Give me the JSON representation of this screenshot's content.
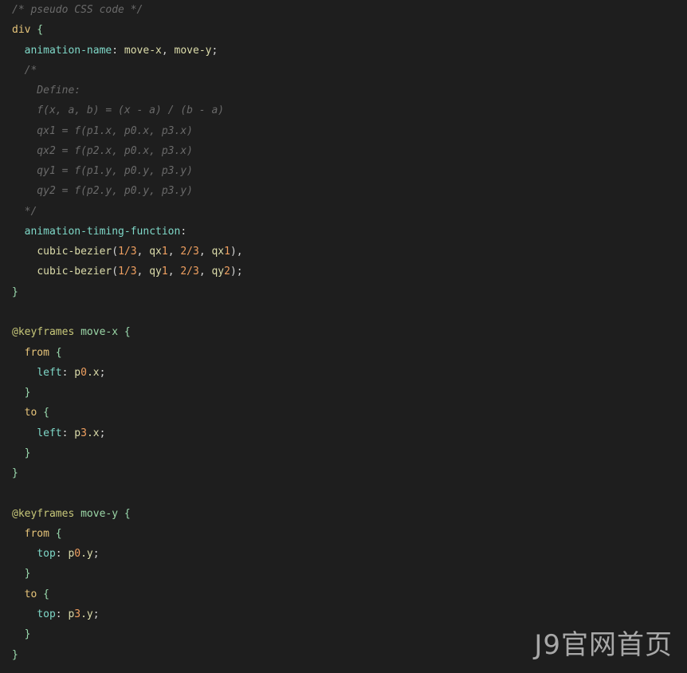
{
  "code": {
    "lines": [
      [
        {
          "t": "/* pseudo CSS code */",
          "c": "t-comment"
        }
      ],
      [
        {
          "t": "div",
          "c": "t-sel"
        },
        {
          "t": " {",
          "c": "t-brace"
        }
      ],
      [
        {
          "t": "  ",
          "c": "t-punct"
        },
        {
          "t": "animation-name",
          "c": "t-prop2"
        },
        {
          "t": ": ",
          "c": "t-punct"
        },
        {
          "t": "move-x",
          "c": "t-val"
        },
        {
          "t": ", ",
          "c": "t-punct"
        },
        {
          "t": "move-y",
          "c": "t-val"
        },
        {
          "t": ";",
          "c": "t-punct"
        }
      ],
      [
        {
          "t": "  /*",
          "c": "t-comment"
        }
      ],
      [
        {
          "t": "    Define:",
          "c": "t-comment"
        }
      ],
      [
        {
          "t": "    f(x, a, b) = (x - a) / (b - a)",
          "c": "t-comment"
        }
      ],
      [
        {
          "t": "    qx1 = f(p1.x, p0.x, p3.x)",
          "c": "t-comment"
        }
      ],
      [
        {
          "t": "    qx2 = f(p2.x, p0.x, p3.x)",
          "c": "t-comment"
        }
      ],
      [
        {
          "t": "    qy1 = f(p1.y, p0.y, p3.y)",
          "c": "t-comment"
        }
      ],
      [
        {
          "t": "    qy2 = f(p2.y, p0.y, p3.y)",
          "c": "t-comment"
        }
      ],
      [
        {
          "t": "  */",
          "c": "t-comment"
        }
      ],
      [
        {
          "t": "  ",
          "c": "t-punct"
        },
        {
          "t": "animation-timing-function",
          "c": "t-prop2"
        },
        {
          "t": ":",
          "c": "t-punct"
        }
      ],
      [
        {
          "t": "    ",
          "c": "t-punct"
        },
        {
          "t": "cubic-bezier",
          "c": "t-val"
        },
        {
          "t": "(",
          "c": "t-punct"
        },
        {
          "t": "1/3",
          "c": "t-num"
        },
        {
          "t": ", ",
          "c": "t-punct"
        },
        {
          "t": "qx",
          "c": "t-val"
        },
        {
          "t": "1",
          "c": "t-num"
        },
        {
          "t": ", ",
          "c": "t-punct"
        },
        {
          "t": "2/3",
          "c": "t-num"
        },
        {
          "t": ", ",
          "c": "t-punct"
        },
        {
          "t": "qx",
          "c": "t-val"
        },
        {
          "t": "1",
          "c": "t-num"
        },
        {
          "t": "),",
          "c": "t-punct"
        }
      ],
      [
        {
          "t": "    ",
          "c": "t-punct"
        },
        {
          "t": "cubic-bezier",
          "c": "t-val"
        },
        {
          "t": "(",
          "c": "t-punct"
        },
        {
          "t": "1/3",
          "c": "t-num"
        },
        {
          "t": ", ",
          "c": "t-punct"
        },
        {
          "t": "qy",
          "c": "t-val"
        },
        {
          "t": "1",
          "c": "t-num"
        },
        {
          "t": ", ",
          "c": "t-punct"
        },
        {
          "t": "2/3",
          "c": "t-num"
        },
        {
          "t": ", ",
          "c": "t-punct"
        },
        {
          "t": "qy",
          "c": "t-val"
        },
        {
          "t": "2",
          "c": "t-num"
        },
        {
          "t": ");",
          "c": "t-punct"
        }
      ],
      [
        {
          "t": "}",
          "c": "t-brace"
        }
      ],
      [
        {
          "t": "",
          "c": "t-punct"
        }
      ],
      [
        {
          "t": "@keyframes",
          "c": "t-at"
        },
        {
          "t": " ",
          "c": "t-punct"
        },
        {
          "t": "move-x",
          "c": "t-anim"
        },
        {
          "t": " {",
          "c": "t-brace"
        }
      ],
      [
        {
          "t": "  ",
          "c": "t-punct"
        },
        {
          "t": "from",
          "c": "t-sel"
        },
        {
          "t": " {",
          "c": "t-brace"
        }
      ],
      [
        {
          "t": "    ",
          "c": "t-punct"
        },
        {
          "t": "left",
          "c": "t-prop2"
        },
        {
          "t": ": ",
          "c": "t-punct"
        },
        {
          "t": "p",
          "c": "t-val"
        },
        {
          "t": "0",
          "c": "t-num"
        },
        {
          "t": ".x",
          "c": "t-val"
        },
        {
          "t": ";",
          "c": "t-punct"
        }
      ],
      [
        {
          "t": "  }",
          "c": "t-brace"
        }
      ],
      [
        {
          "t": "  ",
          "c": "t-punct"
        },
        {
          "t": "to",
          "c": "t-sel"
        },
        {
          "t": " {",
          "c": "t-brace"
        }
      ],
      [
        {
          "t": "    ",
          "c": "t-punct"
        },
        {
          "t": "left",
          "c": "t-prop2"
        },
        {
          "t": ": ",
          "c": "t-punct"
        },
        {
          "t": "p",
          "c": "t-val"
        },
        {
          "t": "3",
          "c": "t-num"
        },
        {
          "t": ".x",
          "c": "t-val"
        },
        {
          "t": ";",
          "c": "t-punct"
        }
      ],
      [
        {
          "t": "  }",
          "c": "t-brace"
        }
      ],
      [
        {
          "t": "}",
          "c": "t-brace"
        }
      ],
      [
        {
          "t": "",
          "c": "t-punct"
        }
      ],
      [
        {
          "t": "@keyframes",
          "c": "t-at"
        },
        {
          "t": " ",
          "c": "t-punct"
        },
        {
          "t": "move-y",
          "c": "t-anim"
        },
        {
          "t": " {",
          "c": "t-brace"
        }
      ],
      [
        {
          "t": "  ",
          "c": "t-punct"
        },
        {
          "t": "from",
          "c": "t-sel"
        },
        {
          "t": " {",
          "c": "t-brace"
        }
      ],
      [
        {
          "t": "    ",
          "c": "t-punct"
        },
        {
          "t": "top",
          "c": "t-prop2"
        },
        {
          "t": ": ",
          "c": "t-punct"
        },
        {
          "t": "p",
          "c": "t-val"
        },
        {
          "t": "0",
          "c": "t-num"
        },
        {
          "t": ".y",
          "c": "t-val"
        },
        {
          "t": ";",
          "c": "t-punct"
        }
      ],
      [
        {
          "t": "  }",
          "c": "t-brace"
        }
      ],
      [
        {
          "t": "  ",
          "c": "t-punct"
        },
        {
          "t": "to",
          "c": "t-sel"
        },
        {
          "t": " {",
          "c": "t-brace"
        }
      ],
      [
        {
          "t": "    ",
          "c": "t-punct"
        },
        {
          "t": "top",
          "c": "t-prop2"
        },
        {
          "t": ": ",
          "c": "t-punct"
        },
        {
          "t": "p",
          "c": "t-val"
        },
        {
          "t": "3",
          "c": "t-num"
        },
        {
          "t": ".y",
          "c": "t-val"
        },
        {
          "t": ";",
          "c": "t-punct"
        }
      ],
      [
        {
          "t": "  }",
          "c": "t-brace"
        }
      ],
      [
        {
          "t": "}",
          "c": "t-brace"
        }
      ]
    ]
  },
  "watermark": {
    "text": "J9官网首页"
  },
  "colors": {
    "background": "#1e1e1e",
    "comment": "#6a6a6a",
    "selector": "#e6c47a",
    "property": "#7fd8c8",
    "value": "#dcdcaa",
    "number": "#f0a060",
    "at_rule": "#c8c87a",
    "brace": "#9cdcb0"
  }
}
